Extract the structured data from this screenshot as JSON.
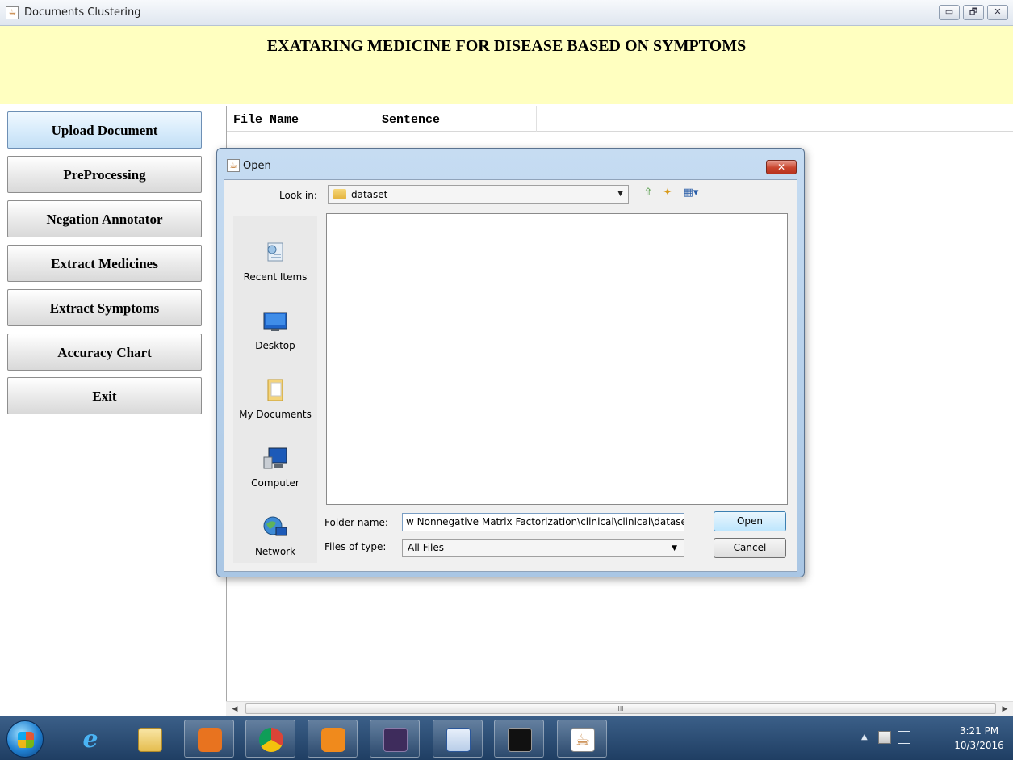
{
  "window": {
    "title": "Documents Clustering",
    "icon": "java-coffee-icon",
    "controls": {
      "minimize": "▭",
      "restore": "🗗",
      "close": "✕"
    }
  },
  "header": {
    "heading": "EXATARING MEDICINE FOR DISEASE BASED ON SYMPTOMS"
  },
  "sidebar": {
    "buttons": [
      "Upload Document",
      "PreProcessing",
      "Negation Annotator",
      "Extract Medicines",
      "Extract Symptoms",
      "Accuracy Chart",
      "Exit"
    ]
  },
  "table": {
    "columns": [
      "File Name",
      "Sentence"
    ],
    "scroll_thumb": "III"
  },
  "dialog": {
    "title": "Open",
    "close_symbol": "✕",
    "look_in_label": "Look in:",
    "look_in_value": "dataset",
    "places": [
      "Recent Items",
      "Desktop",
      "My Documents",
      "Computer",
      "Network"
    ],
    "folder_name_label": "Folder name:",
    "folder_name_value": "w Nonnegative Matrix Factorization\\clinical\\clinical\\dataset",
    "files_of_type_label": "Files of type:",
    "files_of_type_value": "All Files",
    "open_label": "Open",
    "cancel_label": "Cancel"
  },
  "taskbar": {
    "clock_time": "3:21 PM",
    "clock_date": "10/3/2016",
    "apps": [
      "internet-explorer-icon",
      "file-explorer-icon",
      "media-player-icon",
      "chrome-icon",
      "uc-browser-icon",
      "java-ee-ide-icon",
      "word-icon",
      "command-prompt-icon",
      "java-icon"
    ]
  },
  "colors": {
    "header_bg": "#ffffc0",
    "active_button": "#d6ebfb",
    "taskbar": "#2a4d78"
  }
}
